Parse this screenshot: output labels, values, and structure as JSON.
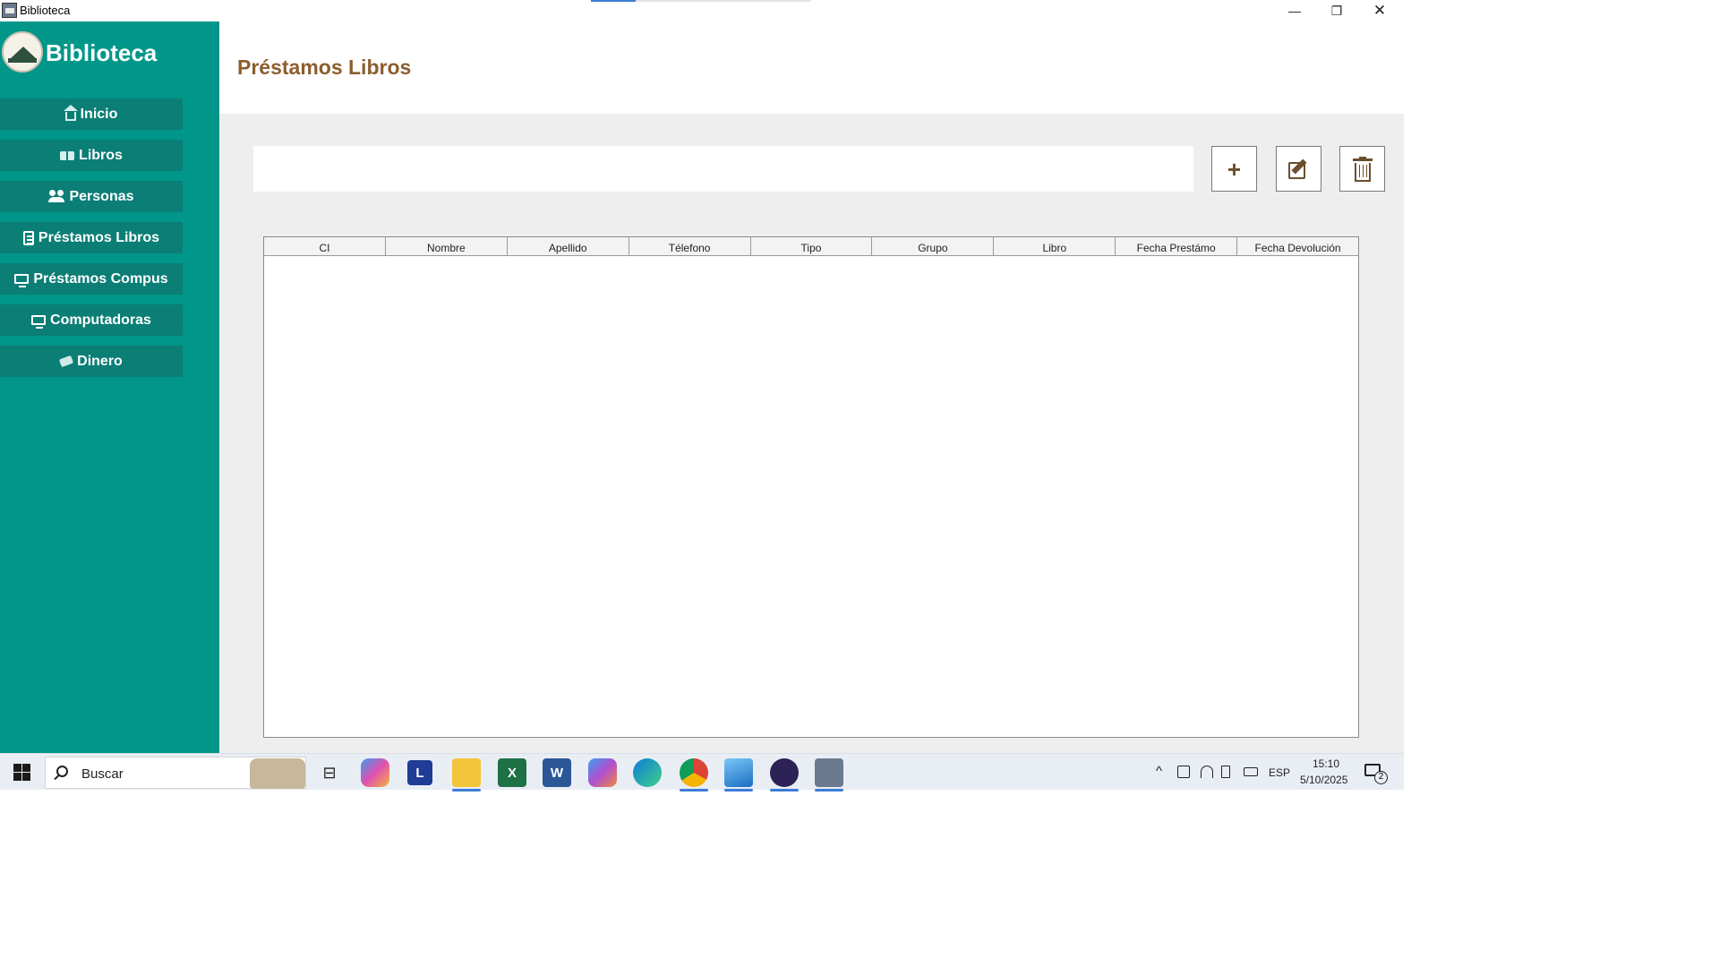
{
  "window": {
    "title": "Biblioteca",
    "minimize_icon": "minimize-icon",
    "maximize_icon": "restore-icon",
    "close_icon": "close-icon",
    "min_label": "—",
    "max_label": "❐",
    "close_label": "✕"
  },
  "sidebar": {
    "brand": "Biblioteca",
    "items": [
      {
        "label": "Inicio",
        "icon": "home-icon"
      },
      {
        "label": "Libros",
        "icon": "book-icon"
      },
      {
        "label": "Personas",
        "icon": "people-icon"
      },
      {
        "label": "Préstamos Libros",
        "icon": "clipboard-icon"
      },
      {
        "label": "Préstamos Compus",
        "icon": "monitor-icon"
      },
      {
        "label": "Computadoras",
        "icon": "monitor-icon"
      },
      {
        "label": "Dinero",
        "icon": "money-icon"
      }
    ]
  },
  "main": {
    "title": "Préstamos Libros",
    "search": {
      "value": "",
      "placeholder": ""
    },
    "actions": {
      "add_label": "+",
      "add_icon": "plus-icon",
      "edit_icon": "edit-icon",
      "delete_icon": "trash-icon"
    },
    "table": {
      "columns": [
        "CI",
        "Nombre",
        "Apellido",
        "Télefono",
        "Tipo",
        "Grupo",
        "Libro",
        "Fecha Prestámo",
        "Fecha Devolución"
      ],
      "rows": []
    }
  },
  "taskbar": {
    "search_label": "Buscar",
    "apps": [
      {
        "name": "task-view",
        "label": "⊟"
      },
      {
        "name": "copilot",
        "label": ""
      },
      {
        "name": "lexicon",
        "label": "L"
      },
      {
        "name": "file-explorer",
        "label": ""
      },
      {
        "name": "excel",
        "label": "X"
      },
      {
        "name": "word",
        "label": "W"
      },
      {
        "name": "m365",
        "label": ""
      },
      {
        "name": "edge",
        "label": ""
      },
      {
        "name": "chrome",
        "label": ""
      },
      {
        "name": "photos",
        "label": ""
      },
      {
        "name": "eclipse",
        "label": ""
      },
      {
        "name": "biblioteca-app",
        "label": ""
      }
    ],
    "tray": {
      "language": "ESP",
      "time": "15:10",
      "date": "5/10/2025",
      "notifications": "2"
    }
  },
  "colors": {
    "sidebar": "#00968a",
    "nav_button": "#0b7e76",
    "title": "#8b5e2e",
    "content_bg": "#eeeeee"
  }
}
